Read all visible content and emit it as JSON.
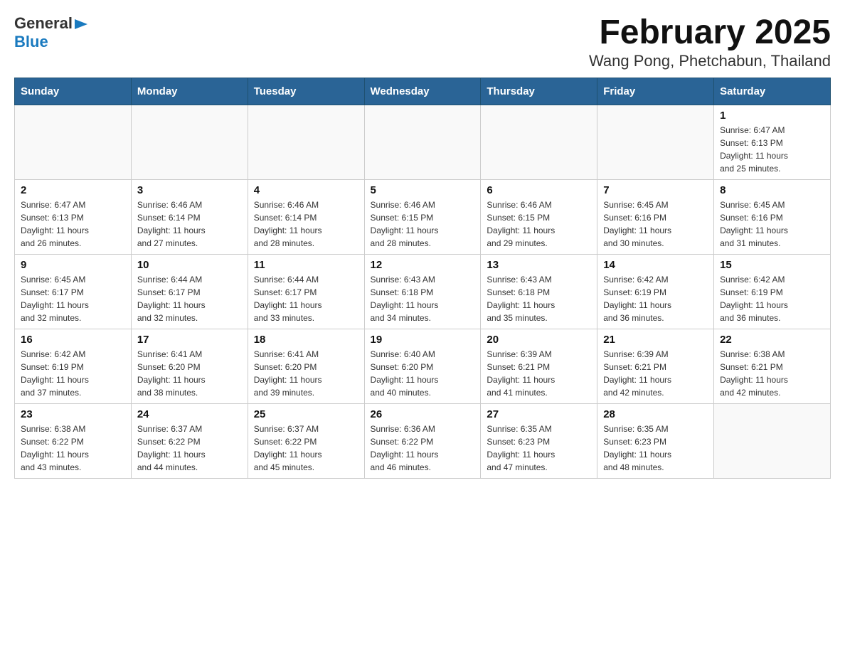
{
  "logo": {
    "general": "General",
    "blue": "Blue",
    "arrow_color": "#1a7abf"
  },
  "title": "February 2025",
  "subtitle": "Wang Pong, Phetchabun, Thailand",
  "days_of_week": [
    "Sunday",
    "Monday",
    "Tuesday",
    "Wednesday",
    "Thursday",
    "Friday",
    "Saturday"
  ],
  "weeks": [
    [
      {
        "day": "",
        "info": ""
      },
      {
        "day": "",
        "info": ""
      },
      {
        "day": "",
        "info": ""
      },
      {
        "day": "",
        "info": ""
      },
      {
        "day": "",
        "info": ""
      },
      {
        "day": "",
        "info": ""
      },
      {
        "day": "1",
        "info": "Sunrise: 6:47 AM\nSunset: 6:13 PM\nDaylight: 11 hours\nand 25 minutes."
      }
    ],
    [
      {
        "day": "2",
        "info": "Sunrise: 6:47 AM\nSunset: 6:13 PM\nDaylight: 11 hours\nand 26 minutes."
      },
      {
        "day": "3",
        "info": "Sunrise: 6:46 AM\nSunset: 6:14 PM\nDaylight: 11 hours\nand 27 minutes."
      },
      {
        "day": "4",
        "info": "Sunrise: 6:46 AM\nSunset: 6:14 PM\nDaylight: 11 hours\nand 28 minutes."
      },
      {
        "day": "5",
        "info": "Sunrise: 6:46 AM\nSunset: 6:15 PM\nDaylight: 11 hours\nand 28 minutes."
      },
      {
        "day": "6",
        "info": "Sunrise: 6:46 AM\nSunset: 6:15 PM\nDaylight: 11 hours\nand 29 minutes."
      },
      {
        "day": "7",
        "info": "Sunrise: 6:45 AM\nSunset: 6:16 PM\nDaylight: 11 hours\nand 30 minutes."
      },
      {
        "day": "8",
        "info": "Sunrise: 6:45 AM\nSunset: 6:16 PM\nDaylight: 11 hours\nand 31 minutes."
      }
    ],
    [
      {
        "day": "9",
        "info": "Sunrise: 6:45 AM\nSunset: 6:17 PM\nDaylight: 11 hours\nand 32 minutes."
      },
      {
        "day": "10",
        "info": "Sunrise: 6:44 AM\nSunset: 6:17 PM\nDaylight: 11 hours\nand 32 minutes."
      },
      {
        "day": "11",
        "info": "Sunrise: 6:44 AM\nSunset: 6:17 PM\nDaylight: 11 hours\nand 33 minutes."
      },
      {
        "day": "12",
        "info": "Sunrise: 6:43 AM\nSunset: 6:18 PM\nDaylight: 11 hours\nand 34 minutes."
      },
      {
        "day": "13",
        "info": "Sunrise: 6:43 AM\nSunset: 6:18 PM\nDaylight: 11 hours\nand 35 minutes."
      },
      {
        "day": "14",
        "info": "Sunrise: 6:42 AM\nSunset: 6:19 PM\nDaylight: 11 hours\nand 36 minutes."
      },
      {
        "day": "15",
        "info": "Sunrise: 6:42 AM\nSunset: 6:19 PM\nDaylight: 11 hours\nand 36 minutes."
      }
    ],
    [
      {
        "day": "16",
        "info": "Sunrise: 6:42 AM\nSunset: 6:19 PM\nDaylight: 11 hours\nand 37 minutes."
      },
      {
        "day": "17",
        "info": "Sunrise: 6:41 AM\nSunset: 6:20 PM\nDaylight: 11 hours\nand 38 minutes."
      },
      {
        "day": "18",
        "info": "Sunrise: 6:41 AM\nSunset: 6:20 PM\nDaylight: 11 hours\nand 39 minutes."
      },
      {
        "day": "19",
        "info": "Sunrise: 6:40 AM\nSunset: 6:20 PM\nDaylight: 11 hours\nand 40 minutes."
      },
      {
        "day": "20",
        "info": "Sunrise: 6:39 AM\nSunset: 6:21 PM\nDaylight: 11 hours\nand 41 minutes."
      },
      {
        "day": "21",
        "info": "Sunrise: 6:39 AM\nSunset: 6:21 PM\nDaylight: 11 hours\nand 42 minutes."
      },
      {
        "day": "22",
        "info": "Sunrise: 6:38 AM\nSunset: 6:21 PM\nDaylight: 11 hours\nand 42 minutes."
      }
    ],
    [
      {
        "day": "23",
        "info": "Sunrise: 6:38 AM\nSunset: 6:22 PM\nDaylight: 11 hours\nand 43 minutes."
      },
      {
        "day": "24",
        "info": "Sunrise: 6:37 AM\nSunset: 6:22 PM\nDaylight: 11 hours\nand 44 minutes."
      },
      {
        "day": "25",
        "info": "Sunrise: 6:37 AM\nSunset: 6:22 PM\nDaylight: 11 hours\nand 45 minutes."
      },
      {
        "day": "26",
        "info": "Sunrise: 6:36 AM\nSunset: 6:22 PM\nDaylight: 11 hours\nand 46 minutes."
      },
      {
        "day": "27",
        "info": "Sunrise: 6:35 AM\nSunset: 6:23 PM\nDaylight: 11 hours\nand 47 minutes."
      },
      {
        "day": "28",
        "info": "Sunrise: 6:35 AM\nSunset: 6:23 PM\nDaylight: 11 hours\nand 48 minutes."
      },
      {
        "day": "",
        "info": ""
      }
    ]
  ]
}
